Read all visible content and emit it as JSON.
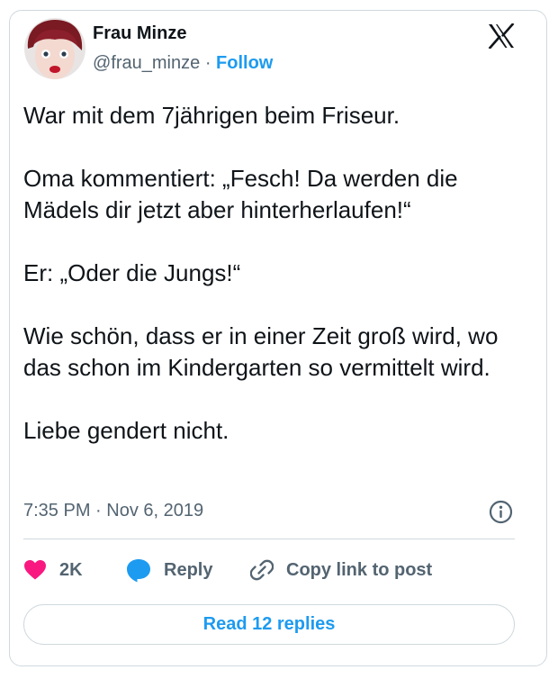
{
  "author": {
    "name": "Frau Minze",
    "handle": "@frau_minze",
    "separator": "·",
    "follow_label": "Follow"
  },
  "tweet": {
    "paragraphs": [
      "War mit dem 7jährigen beim Friseur.",
      "Oma kommentiert: „Fesch! Da werden die Mädels dir jetzt aber hinterherlaufen!“",
      "Er: „Oder die Jungs!“",
      "Wie schön, dass er in einer Zeit groß wird, wo das schon im Kindergarten so vermittelt wird.",
      "Liebe gendert nicht."
    ],
    "timestamp": "7:35 PM · Nov 6, 2019"
  },
  "actions": {
    "like_count": "2K",
    "reply_label": "Reply",
    "copy_label": "Copy link to post"
  },
  "read_replies_label": "Read 12 replies",
  "colors": {
    "accent": "#1d9bf0",
    "like": "#f91880",
    "text": "#0f1419",
    "muted": "#536471",
    "border": "#cfd9de"
  },
  "icons": {
    "platform": "x-logo-icon",
    "info": "info-icon",
    "like": "heart-icon",
    "reply": "speech-bubble-icon",
    "copy": "link-icon"
  }
}
